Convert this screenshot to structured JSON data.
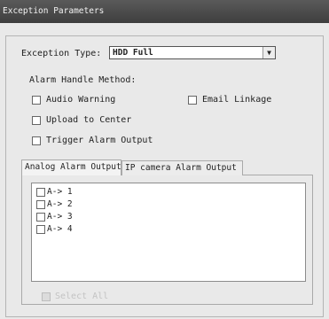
{
  "window": {
    "title": "Exception Parameters"
  },
  "exception": {
    "type_label": "Exception Type:",
    "type_value": "HDD Full"
  },
  "alarm": {
    "section_label": "Alarm Handle Method:",
    "options": {
      "audio_warning": "Audio Warning",
      "email_linkage": "Email Linkage",
      "upload_to_center": "Upload to Center",
      "trigger_alarm_output": "Trigger Alarm Output"
    }
  },
  "tabs": {
    "analog": "Analog Alarm Output",
    "ip_camera": "IP camera Alarm Output",
    "active": "analog"
  },
  "outputs": [
    "A-> 1",
    "A-> 2",
    "A-> 3",
    "A-> 4"
  ],
  "select_all": {
    "label": "Select All",
    "enabled": false
  },
  "icons": {
    "dropdown": "chevron-down-icon"
  }
}
